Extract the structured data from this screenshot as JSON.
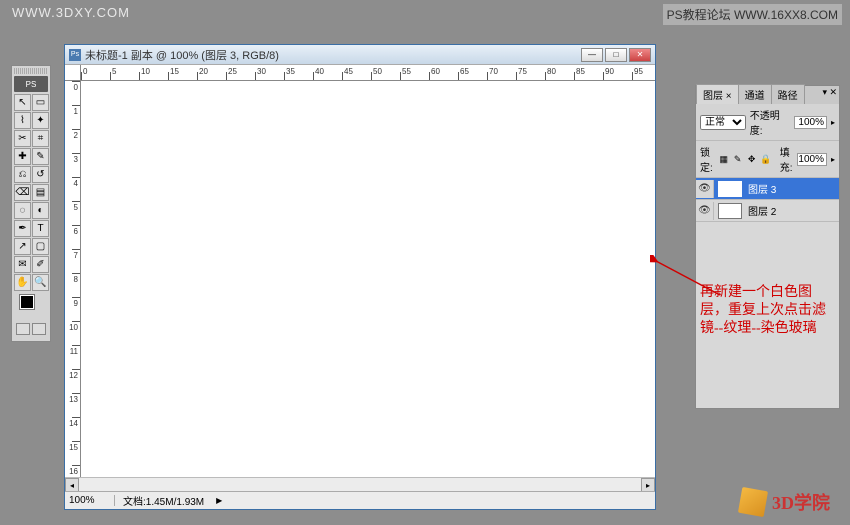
{
  "watermarks": {
    "top_left": "WWW.3DXY.COM",
    "top_right": "PS教程论坛 WWW.16XX8.COM",
    "bottom_right": "3D学院"
  },
  "toolbox": {
    "badge": "PS",
    "tools": [
      {
        "name": "move-tool",
        "glyph": "↖"
      },
      {
        "name": "marquee-tool",
        "glyph": "▭"
      },
      {
        "name": "lasso-tool",
        "glyph": "⌇"
      },
      {
        "name": "wand-tool",
        "glyph": "✦"
      },
      {
        "name": "crop-tool",
        "glyph": "✂"
      },
      {
        "name": "slice-tool",
        "glyph": "⌗"
      },
      {
        "name": "heal-tool",
        "glyph": "✚"
      },
      {
        "name": "brush-tool",
        "glyph": "✎"
      },
      {
        "name": "stamp-tool",
        "glyph": "⎌"
      },
      {
        "name": "history-brush",
        "glyph": "↺"
      },
      {
        "name": "eraser-tool",
        "glyph": "⌫"
      },
      {
        "name": "gradient-tool",
        "glyph": "▤"
      },
      {
        "name": "blur-tool",
        "glyph": "◌"
      },
      {
        "name": "dodge-tool",
        "glyph": "◐"
      },
      {
        "name": "pen-tool",
        "glyph": "✒"
      },
      {
        "name": "type-tool",
        "glyph": "T"
      },
      {
        "name": "path-tool",
        "glyph": "↗"
      },
      {
        "name": "shape-tool",
        "glyph": "▢"
      },
      {
        "name": "notes-tool",
        "glyph": "✉"
      },
      {
        "name": "eyedropper",
        "glyph": "✐"
      },
      {
        "name": "hand-tool",
        "glyph": "✋"
      },
      {
        "name": "zoom-tool",
        "glyph": "🔍"
      }
    ]
  },
  "document": {
    "title": "未标题-1 副本 @ 100% (图层 3, RGB/8)",
    "zoom": "100%",
    "docinfo": "文档:1.45M/1.93M",
    "ruler_ticks": [
      0,
      5,
      10,
      15,
      20,
      25,
      30,
      35,
      40,
      45,
      50,
      55,
      60,
      65,
      70,
      75,
      80,
      85,
      90,
      95
    ]
  },
  "layers_panel": {
    "tabs": [
      "图层 ×",
      "通道",
      "路径"
    ],
    "blend_mode": "正常",
    "opacity_label": "不透明度:",
    "opacity_value": "100%",
    "lock_label": "锁定:",
    "fill_label": "填充:",
    "fill_value": "100%",
    "layers": [
      {
        "name": "图层 3",
        "selected": true
      },
      {
        "name": "图层 2",
        "selected": false
      }
    ]
  },
  "annotation": {
    "text": "再新建一个白色图层，重复上次点击滤镜--纹理--染色玻璃"
  }
}
